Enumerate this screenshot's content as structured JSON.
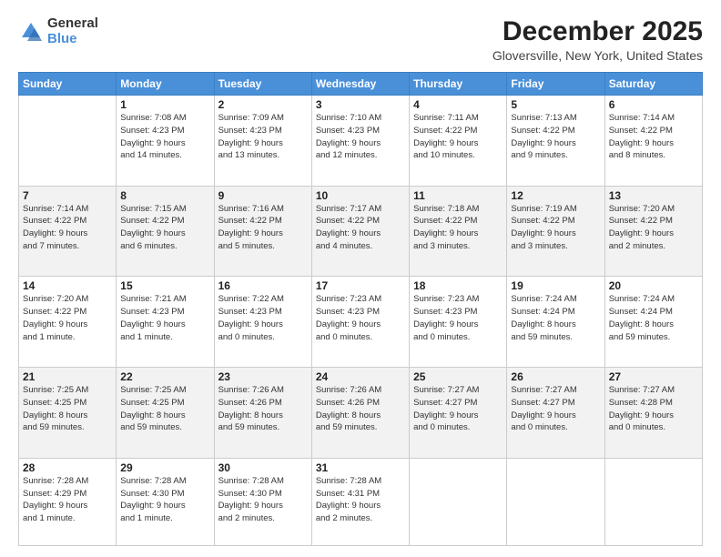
{
  "logo": {
    "general": "General",
    "blue": "Blue"
  },
  "title": "December 2025",
  "location": "Gloversville, New York, United States",
  "days_of_week": [
    "Sunday",
    "Monday",
    "Tuesday",
    "Wednesday",
    "Thursday",
    "Friday",
    "Saturday"
  ],
  "weeks": [
    [
      {
        "day": "",
        "info": ""
      },
      {
        "day": "1",
        "info": "Sunrise: 7:08 AM\nSunset: 4:23 PM\nDaylight: 9 hours\nand 14 minutes."
      },
      {
        "day": "2",
        "info": "Sunrise: 7:09 AM\nSunset: 4:23 PM\nDaylight: 9 hours\nand 13 minutes."
      },
      {
        "day": "3",
        "info": "Sunrise: 7:10 AM\nSunset: 4:23 PM\nDaylight: 9 hours\nand 12 minutes."
      },
      {
        "day": "4",
        "info": "Sunrise: 7:11 AM\nSunset: 4:22 PM\nDaylight: 9 hours\nand 10 minutes."
      },
      {
        "day": "5",
        "info": "Sunrise: 7:13 AM\nSunset: 4:22 PM\nDaylight: 9 hours\nand 9 minutes."
      },
      {
        "day": "6",
        "info": "Sunrise: 7:14 AM\nSunset: 4:22 PM\nDaylight: 9 hours\nand 8 minutes."
      }
    ],
    [
      {
        "day": "7",
        "info": "Sunrise: 7:14 AM\nSunset: 4:22 PM\nDaylight: 9 hours\nand 7 minutes."
      },
      {
        "day": "8",
        "info": "Sunrise: 7:15 AM\nSunset: 4:22 PM\nDaylight: 9 hours\nand 6 minutes."
      },
      {
        "day": "9",
        "info": "Sunrise: 7:16 AM\nSunset: 4:22 PM\nDaylight: 9 hours\nand 5 minutes."
      },
      {
        "day": "10",
        "info": "Sunrise: 7:17 AM\nSunset: 4:22 PM\nDaylight: 9 hours\nand 4 minutes."
      },
      {
        "day": "11",
        "info": "Sunrise: 7:18 AM\nSunset: 4:22 PM\nDaylight: 9 hours\nand 3 minutes."
      },
      {
        "day": "12",
        "info": "Sunrise: 7:19 AM\nSunset: 4:22 PM\nDaylight: 9 hours\nand 3 minutes."
      },
      {
        "day": "13",
        "info": "Sunrise: 7:20 AM\nSunset: 4:22 PM\nDaylight: 9 hours\nand 2 minutes."
      }
    ],
    [
      {
        "day": "14",
        "info": "Sunrise: 7:20 AM\nSunset: 4:22 PM\nDaylight: 9 hours\nand 1 minute."
      },
      {
        "day": "15",
        "info": "Sunrise: 7:21 AM\nSunset: 4:23 PM\nDaylight: 9 hours\nand 1 minute."
      },
      {
        "day": "16",
        "info": "Sunrise: 7:22 AM\nSunset: 4:23 PM\nDaylight: 9 hours\nand 0 minutes."
      },
      {
        "day": "17",
        "info": "Sunrise: 7:23 AM\nSunset: 4:23 PM\nDaylight: 9 hours\nand 0 minutes."
      },
      {
        "day": "18",
        "info": "Sunrise: 7:23 AM\nSunset: 4:23 PM\nDaylight: 9 hours\nand 0 minutes."
      },
      {
        "day": "19",
        "info": "Sunrise: 7:24 AM\nSunset: 4:24 PM\nDaylight: 8 hours\nand 59 minutes."
      },
      {
        "day": "20",
        "info": "Sunrise: 7:24 AM\nSunset: 4:24 PM\nDaylight: 8 hours\nand 59 minutes."
      }
    ],
    [
      {
        "day": "21",
        "info": "Sunrise: 7:25 AM\nSunset: 4:25 PM\nDaylight: 8 hours\nand 59 minutes."
      },
      {
        "day": "22",
        "info": "Sunrise: 7:25 AM\nSunset: 4:25 PM\nDaylight: 8 hours\nand 59 minutes."
      },
      {
        "day": "23",
        "info": "Sunrise: 7:26 AM\nSunset: 4:26 PM\nDaylight: 8 hours\nand 59 minutes."
      },
      {
        "day": "24",
        "info": "Sunrise: 7:26 AM\nSunset: 4:26 PM\nDaylight: 8 hours\nand 59 minutes."
      },
      {
        "day": "25",
        "info": "Sunrise: 7:27 AM\nSunset: 4:27 PM\nDaylight: 9 hours\nand 0 minutes."
      },
      {
        "day": "26",
        "info": "Sunrise: 7:27 AM\nSunset: 4:27 PM\nDaylight: 9 hours\nand 0 minutes."
      },
      {
        "day": "27",
        "info": "Sunrise: 7:27 AM\nSunset: 4:28 PM\nDaylight: 9 hours\nand 0 minutes."
      }
    ],
    [
      {
        "day": "28",
        "info": "Sunrise: 7:28 AM\nSunset: 4:29 PM\nDaylight: 9 hours\nand 1 minute."
      },
      {
        "day": "29",
        "info": "Sunrise: 7:28 AM\nSunset: 4:30 PM\nDaylight: 9 hours\nand 1 minute."
      },
      {
        "day": "30",
        "info": "Sunrise: 7:28 AM\nSunset: 4:30 PM\nDaylight: 9 hours\nand 2 minutes."
      },
      {
        "day": "31",
        "info": "Sunrise: 7:28 AM\nSunset: 4:31 PM\nDaylight: 9 hours\nand 2 minutes."
      },
      {
        "day": "",
        "info": ""
      },
      {
        "day": "",
        "info": ""
      },
      {
        "day": "",
        "info": ""
      }
    ]
  ]
}
